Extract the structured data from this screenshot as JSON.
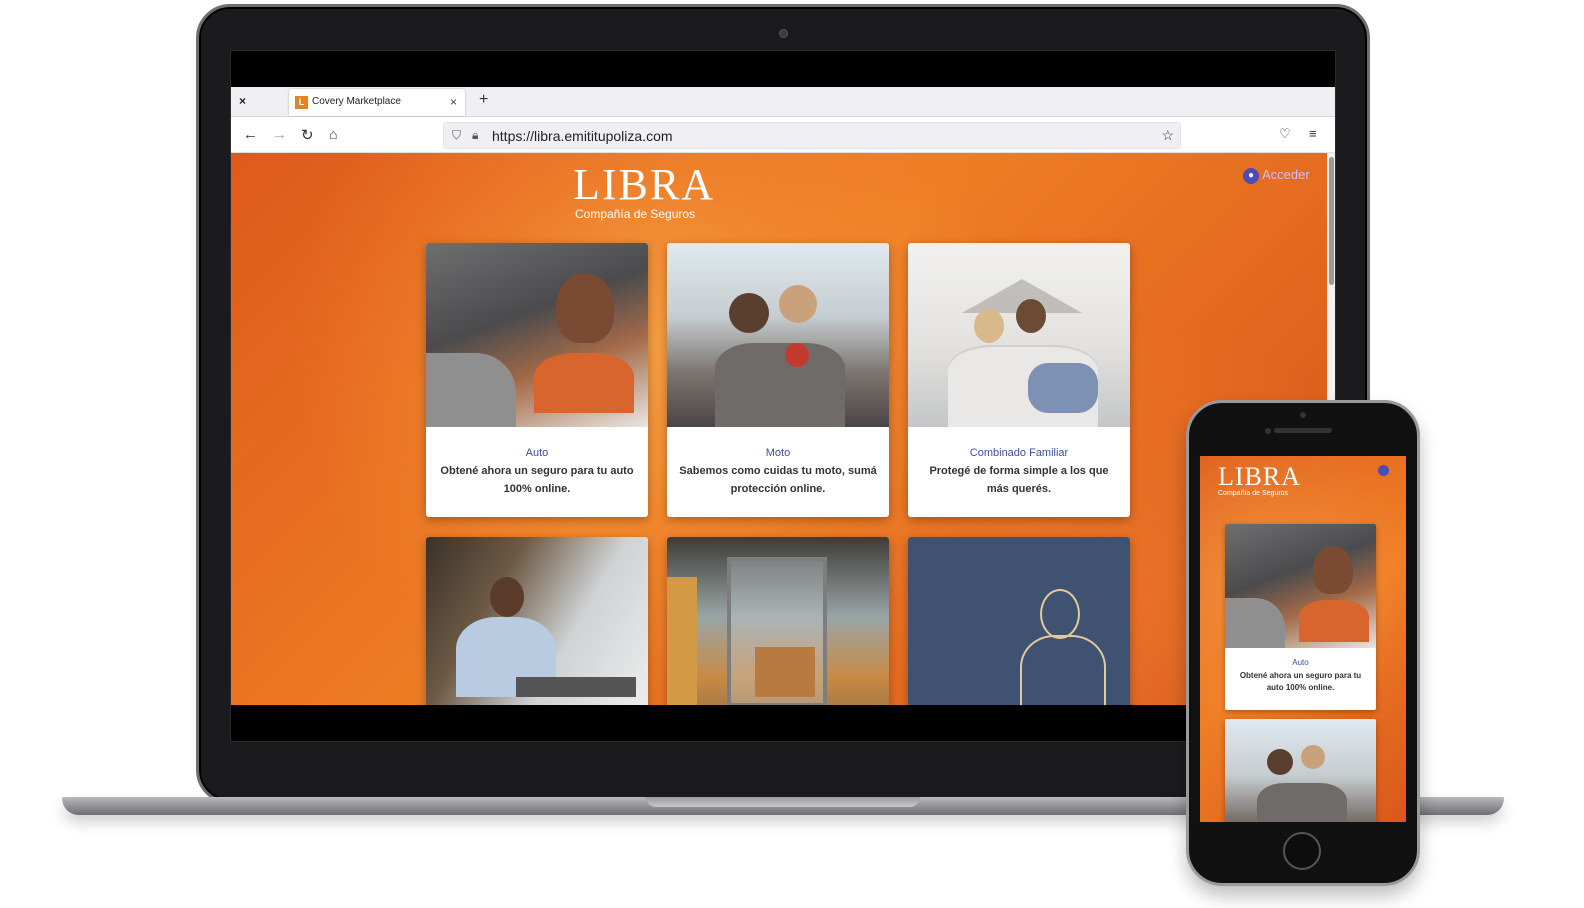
{
  "browser": {
    "tab_title": "Covery Marketplace",
    "tab_favicon": "L",
    "close_glyph": "×",
    "new_tab_glyph": "+",
    "url": "https://libra.emititupoliza.com",
    "icons": [
      "back-icon",
      "forward-icon",
      "reload-icon",
      "home-icon",
      "shield-icon",
      "lock-icon",
      "star-icon",
      "pocket-icon",
      "menu-icon"
    ]
  },
  "site": {
    "logo_word": "LIBRA",
    "logo_sub": "Compañía de Seguros",
    "login_label": "Acceder",
    "cards": [
      {
        "title": "Auto",
        "text": "Obtené ahora un seguro para tu auto 100% online."
      },
      {
        "title": "Moto",
        "text": "Sabemos como cuidas tu moto, sumá protección online."
      },
      {
        "title": "Combinado Familiar",
        "text": "Protegé de forma simple a los que más querés."
      }
    ]
  },
  "phone": {
    "logo_word": "LIBRA",
    "logo_sub": "Compañía de Seguros",
    "card": {
      "title": "Auto",
      "text": "Obtené ahora un seguro para tu auto 100% online."
    }
  },
  "colors": {
    "brand_orange": "#ee7d25",
    "card_title_blue": "#3c4fa0",
    "login_purple": "#4d4bb5"
  }
}
